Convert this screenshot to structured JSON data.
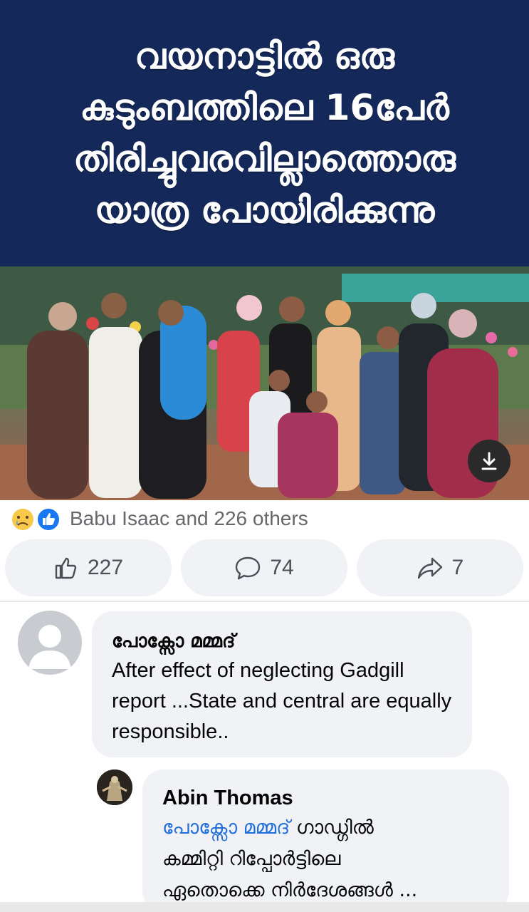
{
  "post": {
    "banner_lines": [
      "വയനാട്ടിൽ ഒരു",
      "കുടുംബത്തിലെ 16പേർ",
      "തിരിച്ചുവരവില്ലാത്തൊരു",
      "യാത്ര പോയിരിക്കുന്നു"
    ]
  },
  "reactions": {
    "icons": [
      "crying-face-icon",
      "thumbs-up-icon"
    ],
    "summary": "Babu Isaac and 226 others"
  },
  "actions": {
    "likes": "227",
    "comments": "74",
    "shares": "7"
  },
  "comments": [
    {
      "author": "പോക്സോ മമ്മദ്",
      "text": "After effect of neglecting Gadgill report ...State and central are equally responsible.."
    }
  ],
  "reply": {
    "author": "Abin Thomas",
    "mention": "പോക്സോ മമ്മദ്",
    "text_line1": " ഗാഡ്ഗിൽ",
    "text_line2": "കമ്മിറ്റി റിപ്പോർട്ടിലെ",
    "text_line3": "ഏതൊക്കെ നിർദേശങ്ങൾ ..."
  },
  "colors": {
    "banner_bg": "#14285a",
    "action_bg": "#f0f2f5",
    "mention": "#216fdb",
    "like_blue": "#1877f2"
  }
}
